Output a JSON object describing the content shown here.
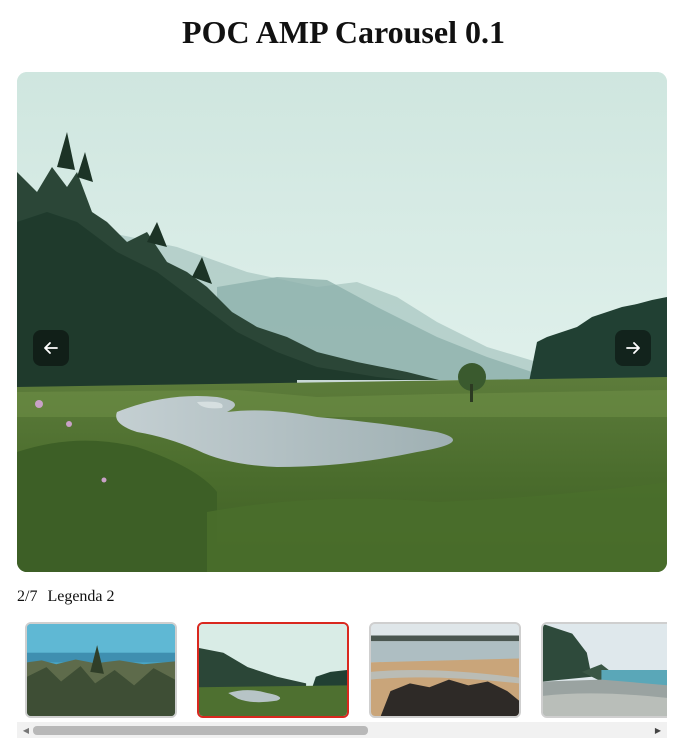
{
  "page": {
    "title": "POC AMP Carousel 0.1"
  },
  "carousel": {
    "counter": "2/7",
    "caption": "Legenda 2",
    "current_index": 2,
    "total": 7,
    "prev_icon": "arrow-left-icon",
    "next_icon": "arrow-right-icon"
  },
  "thumbnails": [
    {
      "name": "thumbnail-1",
      "scene": "forest-lake-horizon"
    },
    {
      "name": "thumbnail-2",
      "scene": "meadow-river-valley",
      "selected": true
    },
    {
      "name": "thumbnail-3",
      "scene": "beach-rocks"
    },
    {
      "name": "thumbnail-4",
      "scene": "pebble-shore-trees"
    }
  ],
  "colors": {
    "selected_border": "#d9281f",
    "thumb_border": "#cfcfcf",
    "nav_button_bg": "rgba(0,0,0,0.45)",
    "scrollbar_thumb": "#b8b8b8"
  },
  "scrollbar": {
    "position_fraction": 0.0,
    "visible_fraction": 0.52
  }
}
